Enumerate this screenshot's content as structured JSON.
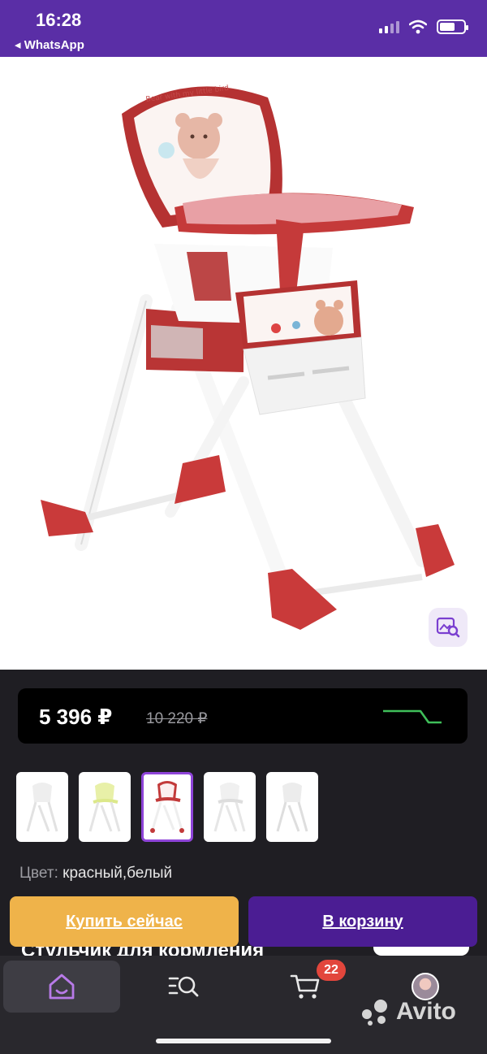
{
  "status_bar": {
    "time": "16:28",
    "back_app": "◂ WhatsApp",
    "signal_icon": "cellular-signal-icon",
    "wifi_icon": "wifi-icon",
    "battery_icon": "battery-icon"
  },
  "product_image": {
    "back_icon": "chevron-left-icon",
    "favorite_icon": "heart-icon",
    "share_icon": "share-icon",
    "zoom_icon": "image-search-icon",
    "tray_label": "Bear with my little bird"
  },
  "price": {
    "current": "5 396 ₽",
    "old": "10 220 ₽",
    "trend_color": "#3fbf5a"
  },
  "thumbnails": {
    "count": 5,
    "selected_index": 2
  },
  "color": {
    "label": "Цвет:",
    "value": "красный,белый"
  },
  "actions": {
    "buy_now": "Купить сейчас",
    "add_to_cart": "В корзину"
  },
  "title_peek": "Стульчик для кормления",
  "bottom_nav": {
    "home_icon": "home-icon",
    "search_icon": "search-list-icon",
    "cart_icon": "cart-icon",
    "cart_badge": "22",
    "profile_icon": "avatar",
    "brand": "Avito"
  },
  "colors": {
    "status_bar": "#5a2ea6",
    "buy_button": "#efb34a",
    "cart_button": "#4b1d93",
    "accent": "#8e44d8",
    "badge": "#e2463c"
  }
}
